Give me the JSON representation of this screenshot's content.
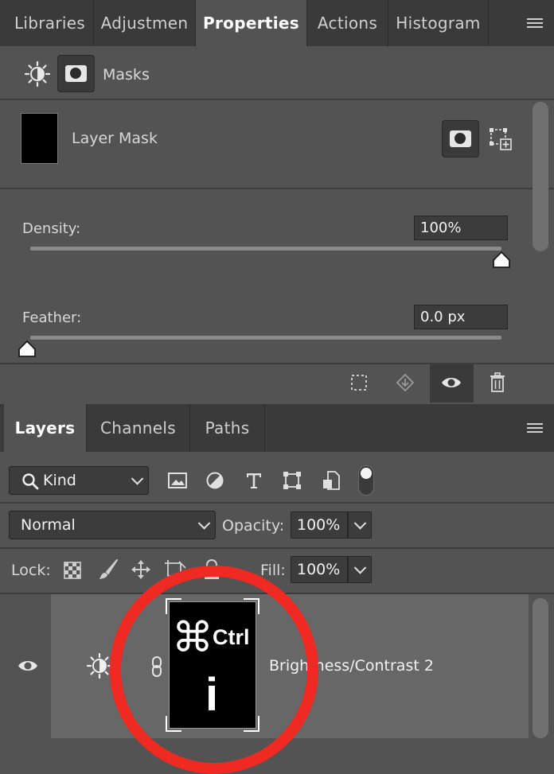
{
  "top_tabs": [
    {
      "label": "Libraries"
    },
    {
      "label": "Adjustmen"
    },
    {
      "label": "Properties"
    },
    {
      "label": "Actions"
    },
    {
      "label": "Histogram"
    }
  ],
  "properties": {
    "section_label": "Masks",
    "mask_name": "Layer Mask",
    "density_label": "Density:",
    "density_value": "100%",
    "density_level": 1.0,
    "feather_label": "Feather:",
    "feather_value": "0.0 px",
    "feather_level": 0.0
  },
  "layers_tabs": [
    {
      "label": "Layers"
    },
    {
      "label": "Channels"
    },
    {
      "label": "Paths"
    }
  ],
  "layers": {
    "filter_kind": "Kind",
    "blend_mode": "Normal",
    "opacity_label": "Opacity:",
    "opacity_value": "100%",
    "lock_label": "Lock:",
    "fill_label": "Fill:",
    "fill_value": "100%",
    "layer_name": "Brightness/Contrast 2"
  },
  "overlay": {
    "cmd_glyph": "⌘",
    "ctrl_text": "Ctrl",
    "key_text": "i",
    "circle_color": "#ee2a22"
  }
}
